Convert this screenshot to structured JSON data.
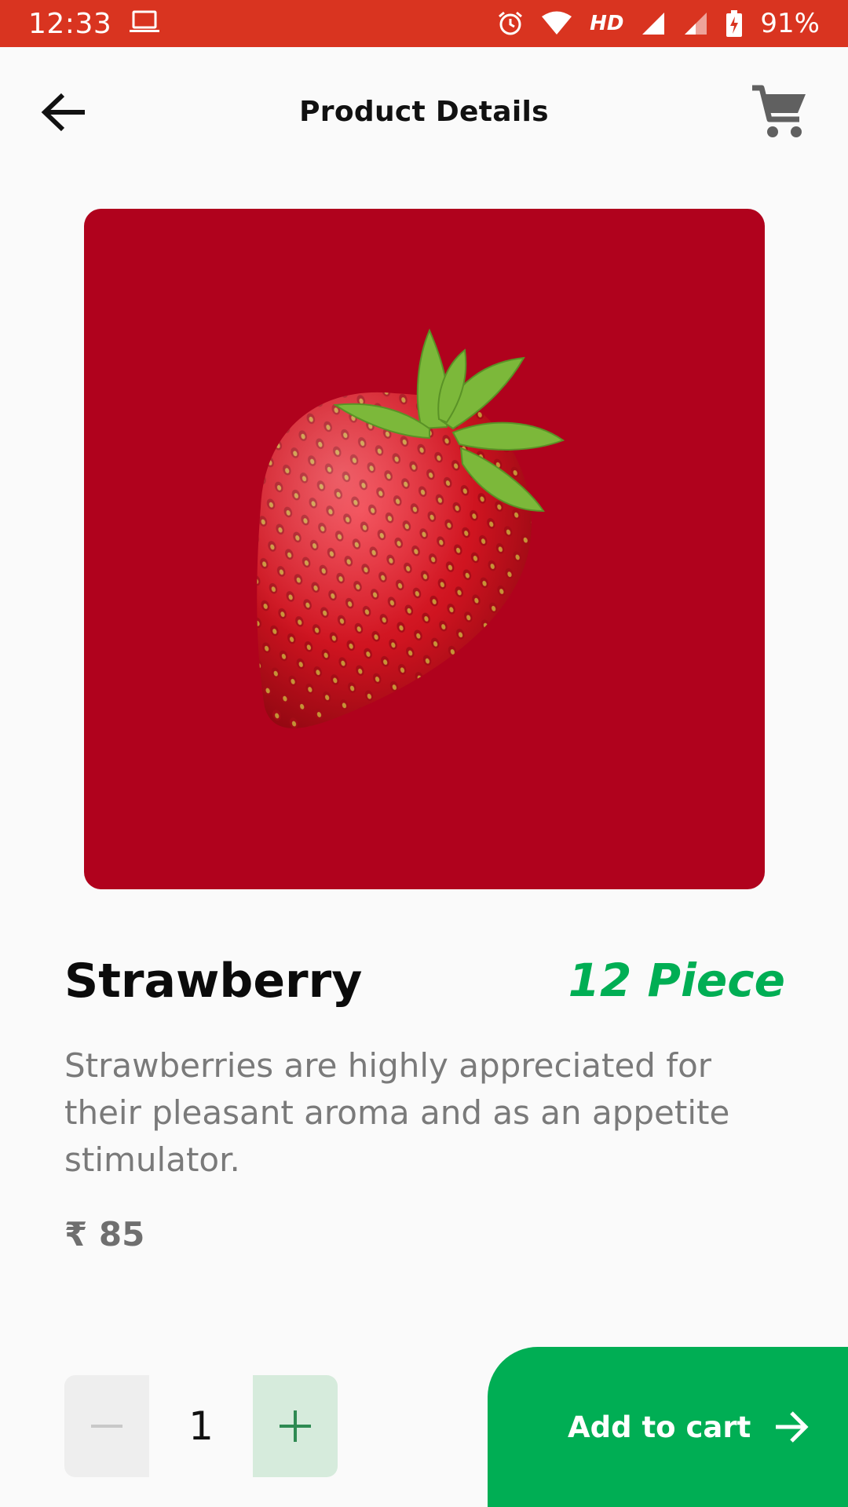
{
  "status_bar": {
    "time": "12:33",
    "network": "HD",
    "battery": "91%",
    "background_color": "#d93420",
    "icons": [
      "laptop-icon",
      "alarm-icon",
      "wifi-icon",
      "signal-icon",
      "signal-icon-2",
      "battery-charging-icon"
    ]
  },
  "app_bar": {
    "title": "Product Details",
    "back_icon": "arrow-back-icon",
    "cart_icon": "shopping-cart-icon"
  },
  "product": {
    "image": "strawberry",
    "image_background": "#b0021d",
    "name": "Strawberry",
    "unit": "12 Piece",
    "description": "Strawberries are highly appreciated for their pleasant aroma and as an appetite stimulator.",
    "price": "₹ 85"
  },
  "quantity": {
    "value": "1",
    "minus_icon": "minus-icon",
    "plus_icon": "plus-icon"
  },
  "cta": {
    "label": "Add to cart",
    "icon": "arrow-forward-icon",
    "color": "#00ae54"
  },
  "colors": {
    "accent": "#00ae54",
    "page_background": "#fafafa"
  }
}
